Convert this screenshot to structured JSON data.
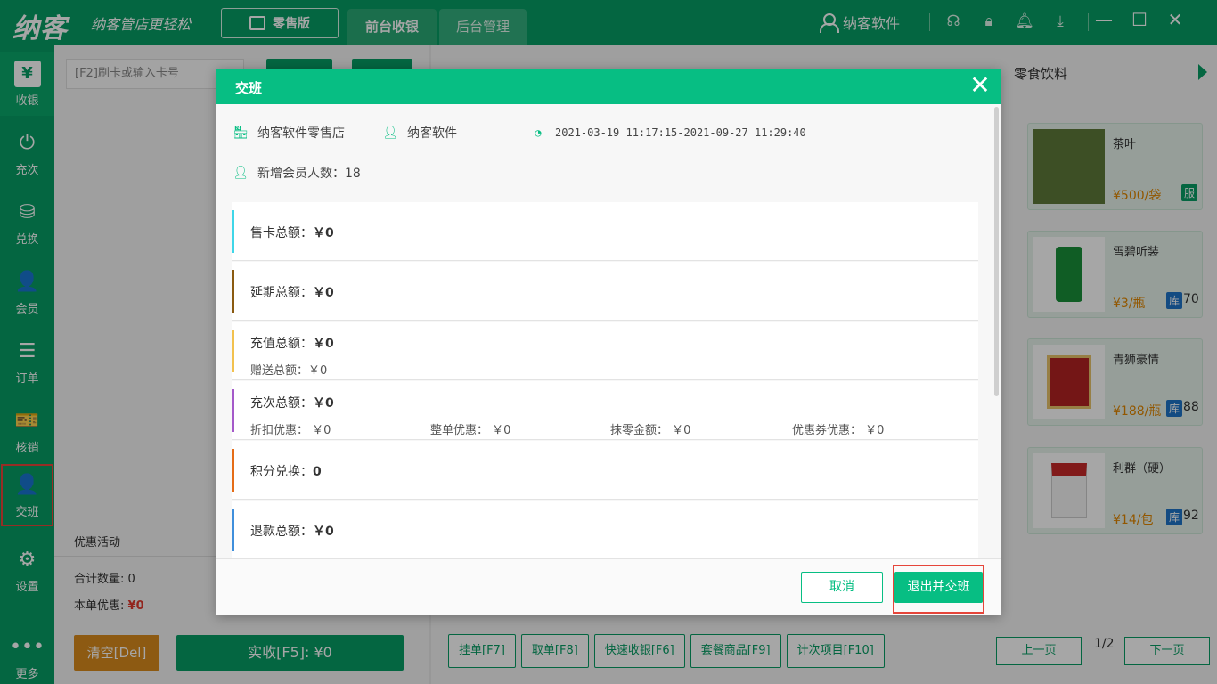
{
  "app": {
    "logo": "纳客",
    "slogan": "纳客管店更轻松",
    "edition": "零售版",
    "tabs": [
      "前台收银",
      "后台管理"
    ],
    "user": "纳客软件"
  },
  "sidenav": {
    "items": [
      {
        "label": "收银",
        "icon": "¥"
      },
      {
        "label": "充次",
        "icon": "⏻"
      },
      {
        "label": "兑换",
        "icon": "⛁"
      },
      {
        "label": "会员",
        "icon": "👤"
      },
      {
        "label": "订单",
        "icon": "☰"
      },
      {
        "label": "核销",
        "icon": "🎫"
      },
      {
        "label": "交班",
        "icon": "👤"
      },
      {
        "label": "设置",
        "icon": "⚙"
      },
      {
        "label": "更多",
        "icon": "•••"
      }
    ]
  },
  "leftpanel": {
    "card_placeholder": "[F2]刷卡或输入卡号",
    "promo_label": "优惠活动",
    "total_qty_label": "合计数量:",
    "total_qty": "0",
    "discount_label": "本单优惠:",
    "discount_value": "¥0",
    "clear_button": "清空[Del]",
    "pay_button": "实收[F5]: ¥0"
  },
  "rightpanel": {
    "category": "零食饮料",
    "products": [
      {
        "name": "茶叶",
        "price": "¥500/袋",
        "badge": "服",
        "stock": ""
      },
      {
        "name": "雪碧听装",
        "price": "¥3/瓶",
        "badge": "库",
        "stock": "70"
      },
      {
        "name": "青狮豪情",
        "price": "¥188/瓶",
        "badge": "库",
        "stock": "88"
      },
      {
        "name": "利群（硬）",
        "price": "¥14/包",
        "badge": "库",
        "stock": "92"
      }
    ],
    "bottom_buttons": [
      "挂单[F7]",
      "取单[F8]",
      "快速收银[F6]",
      "套餐商品[F9]",
      "计次项目[F10]"
    ],
    "prev_page": "上一页",
    "page_indicator": "1/2",
    "next_page": "下一页"
  },
  "dialog": {
    "title": "交班",
    "store": "纳客软件零售店",
    "operator": "纳客软件",
    "time_range": "2021-03-19 11:17:15-2021-09-27 11:29:40",
    "new_members": "新增会员人数：18",
    "rows": [
      {
        "label": "售卡总额：",
        "value": "￥0",
        "color": "#3fd6e8"
      },
      {
        "label": "延期总额：",
        "value": "￥0",
        "color": "#8a5a10"
      },
      {
        "label": "充值总额：",
        "value": "￥0",
        "color": "#f2c14e",
        "sub": "赠送总额：￥0"
      },
      {
        "label": "充次总额：",
        "value": "￥0",
        "color": "#a459c9",
        "subs": [
          "折扣优惠：  ￥0",
          "整单优惠：  ￥0",
          "抹零金额：  ￥0",
          "优惠券优惠：  ￥0"
        ]
      },
      {
        "label": "积分兑换：",
        "value": "0",
        "color": "#e56c17"
      },
      {
        "label": "退款总额：",
        "value": "￥0",
        "color": "#3f8fdc"
      }
    ],
    "cancel_button": "取消",
    "confirm_button": "退出并交班"
  }
}
